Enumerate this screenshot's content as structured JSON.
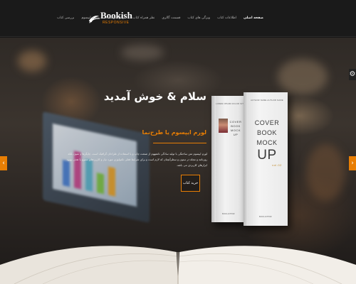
{
  "brand": {
    "name": "Bookish",
    "tagline": "RESPONSIVE"
  },
  "nav": {
    "items": [
      {
        "label": "صفحه اصلی",
        "active": true
      },
      {
        "label": "اطلاعات کتاب",
        "active": false
      },
      {
        "label": "ویژگی های کتاب",
        "active": false
      },
      {
        "label": "قسمت گالری",
        "active": false
      },
      {
        "label": "نظر همراه کتاب",
        "active": false
      },
      {
        "label": "درباره نویسنده",
        "active": false
      },
      {
        "label": "لورم ایپسوم",
        "active": false
      },
      {
        "label": "بررسی کتاب",
        "active": false
      }
    ]
  },
  "hero": {
    "title": "سلام & خوش آمدید",
    "subtitle": "لورم ایپسوم یا طرح‌نما",
    "description": "لورم ایپسوم متن ساختگی با تولید سادگی نامفهوم از صنعت چاپ و با استفاده از طراحان گرافیک است. چاپگرها و متون بلکه روزنامه و مجله در ستون و سطرآنچنان که لازم است و برای شرایط فعلی تکنولوژی مورد نیاز و کاربردهای متنوع با هدف بهبود ابزارهای کاربردی می باشد.",
    "buy_label": "خرید کتاب"
  },
  "books": {
    "back_header": "LOREM IPSUM DOLOR SIT AMET",
    "front_header": "AUTHOR NAME AUTHOR NAME",
    "front_title_lines": [
      "COVER",
      "BOOK",
      "MOCK",
      "UP"
    ],
    "front_edition": "vol.02",
    "back_title_lines": [
      "COVER",
      "BOOK",
      "MOCK",
      "UP"
    ],
    "back_author": "BOOK AUTHOR",
    "front_author": "BOOK AUTHOR",
    "spine_text": "COVER BOOK MOCKUP"
  },
  "controls": {
    "prev_icon": "‹",
    "next_icon": "›",
    "settings_icon": "⚙"
  },
  "colors": {
    "accent": "#e87e04",
    "header_bg": "#1a1a1a"
  }
}
